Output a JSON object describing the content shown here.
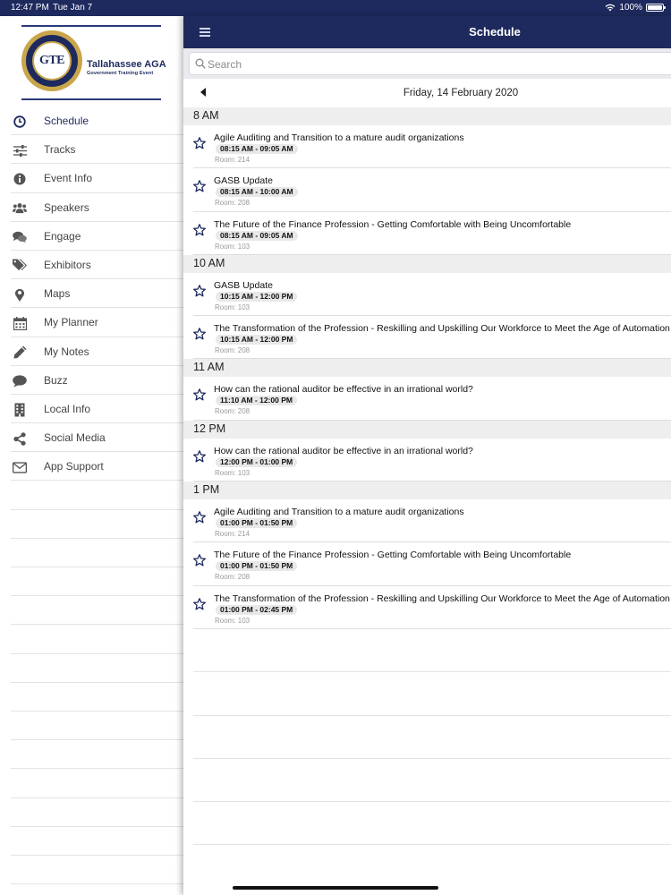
{
  "status_bar": {
    "time": "12:47 PM",
    "date": "Tue Jan 7",
    "battery": "100%"
  },
  "logo": {
    "initials": "GTE",
    "name": "Tallahassee AGA",
    "subtitle": "Government Training Event"
  },
  "sidebar": {
    "items": [
      {
        "label": "Schedule",
        "icon": "clock-icon",
        "active": true
      },
      {
        "label": "Tracks",
        "icon": "sliders-icon"
      },
      {
        "label": "Event Info",
        "icon": "info-icon"
      },
      {
        "label": "Speakers",
        "icon": "users-icon"
      },
      {
        "label": "Engage",
        "icon": "chat-bubbles-icon"
      },
      {
        "label": "Exhibitors",
        "icon": "tags-icon"
      },
      {
        "label": "Maps",
        "icon": "map-pin-icon"
      },
      {
        "label": "My Planner",
        "icon": "calendar-icon"
      },
      {
        "label": "My Notes",
        "icon": "pencil-icon"
      },
      {
        "label": "Buzz",
        "icon": "speech-bubble-icon"
      },
      {
        "label": "Local Info",
        "icon": "building-icon"
      },
      {
        "label": "Social Media",
        "icon": "share-icon"
      },
      {
        "label": "App Support",
        "icon": "envelope-icon"
      }
    ]
  },
  "header": {
    "title": "Schedule"
  },
  "search": {
    "placeholder": "Search"
  },
  "date_nav": {
    "date": "Friday, 14 February 2020"
  },
  "schedule": [
    {
      "hour": "8 AM",
      "sessions": [
        {
          "title": "Agile Auditing and Transition to a mature audit organizations",
          "time": "08:15 AM - 09:05 AM",
          "room": "Room: 214"
        },
        {
          "title": "GASB Update",
          "time": "08:15 AM - 10:00 AM",
          "room": "Room: 208"
        },
        {
          "title": "The Future of the Finance Profession - Getting Comfortable with Being Uncomfortable",
          "time": "08:15 AM - 09:05 AM",
          "room": "Room: 103"
        }
      ]
    },
    {
      "hour": "10 AM",
      "sessions": [
        {
          "title": "GASB Update",
          "time": "10:15 AM - 12:00 PM",
          "room": "Room: 103"
        },
        {
          "title": "The Transformation of the Profession - Reskilling and Upskilling Our Workforce to Meet the Age of Automation",
          "time": "10:15 AM - 12:00 PM",
          "room": "Room: 208"
        }
      ]
    },
    {
      "hour": "11 AM",
      "sessions": [
        {
          "title": "How can the rational auditor be effective in an irrational world?",
          "time": "11:10 AM - 12:00 PM",
          "room": "Room: 208"
        }
      ]
    },
    {
      "hour": "12 PM",
      "sessions": [
        {
          "title": "How can the rational auditor be effective in an irrational world?",
          "time": "12:00 PM - 01:00 PM",
          "room": "Room: 103"
        }
      ]
    },
    {
      "hour": "1 PM",
      "sessions": [
        {
          "title": "Agile Auditing and Transition to a mature audit organizations",
          "time": "01:00 PM - 01:50 PM",
          "room": "Room: 214"
        },
        {
          "title": "The Future of the Finance Profession - Getting Comfortable with Being Uncomfortable",
          "time": "01:00 PM - 01:50 PM",
          "room": "Room: 208"
        },
        {
          "title": "The Transformation of the Profession - Reskilling and Upskilling Our Workforce to Meet the Age of Automation",
          "time": "01:00 PM - 02:45 PM",
          "room": "Room: 103"
        }
      ]
    }
  ],
  "colors": {
    "navbar": "#1e2a5e",
    "accent": "#1e2a5e",
    "gold": "#c9a64b",
    "star_outline": "#1e2a5e"
  }
}
